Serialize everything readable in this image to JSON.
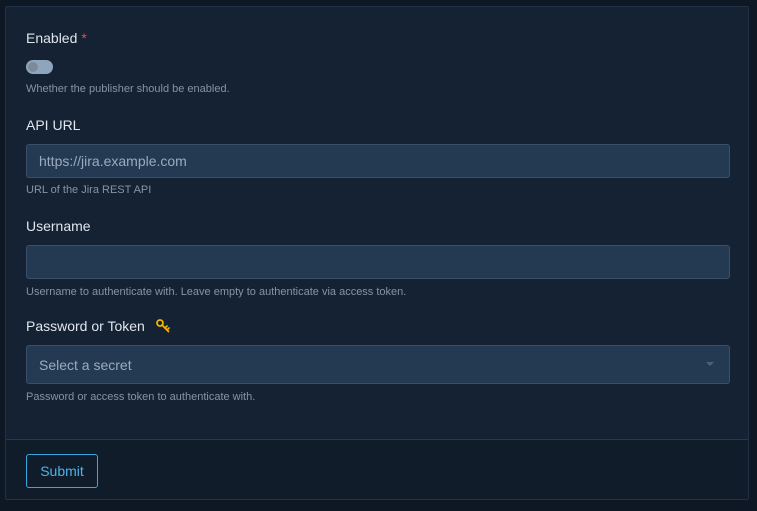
{
  "form": {
    "enabled": {
      "label": "Enabled",
      "required_mark": "*",
      "value": false,
      "help": "Whether the publisher should be enabled."
    },
    "api_url": {
      "label": "API URL",
      "placeholder": "https://jira.example.com",
      "value": "",
      "help": "URL of the Jira REST API"
    },
    "username": {
      "label": "Username",
      "placeholder": "",
      "value": "",
      "help": "Username to authenticate with. Leave empty to authenticate via access token."
    },
    "password": {
      "label": "Password or Token",
      "icon": "key-icon",
      "select_placeholder": "Select a secret",
      "help": "Password or access token to authenticate with."
    }
  },
  "footer": {
    "submit_label": "Submit"
  },
  "colors": {
    "page_bg": "#0d1824",
    "card_bg": "#152233",
    "input_bg": "#243a52",
    "accent": "#39a7df",
    "required": "#e5484d",
    "key_icon": "#f0b400"
  }
}
